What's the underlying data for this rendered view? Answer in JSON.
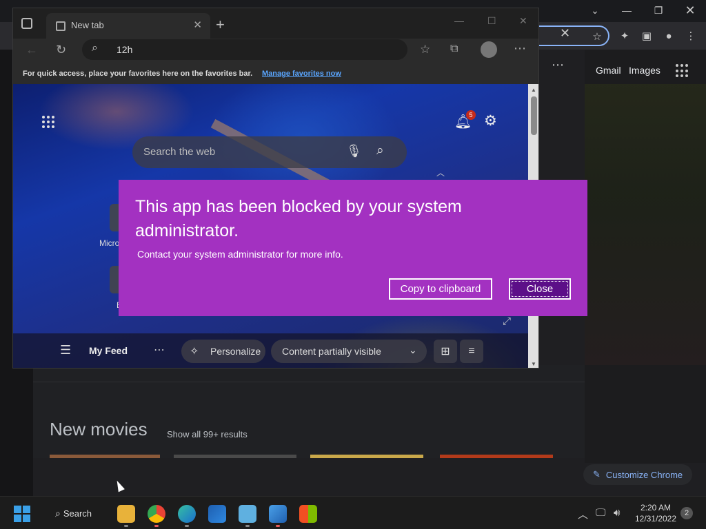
{
  "chrome": {
    "links": {
      "gmail": "Gmail",
      "images": "Images"
    },
    "results": {
      "heading": "New movies",
      "show_all": "Show all 99+ results"
    },
    "customize_label": "Customize Chrome"
  },
  "edge": {
    "tab": {
      "title": "New tab"
    },
    "address": {
      "value": "12h"
    },
    "favorites_bar": {
      "text": "For quick access, place your favorites here on the favorites bar.",
      "link": "Manage favorites now"
    },
    "ntp": {
      "search_placeholder": "Search the web",
      "notification_count": "5",
      "tiles": [
        {
          "label": "Micro"
        },
        {
          "label": "E"
        }
      ],
      "feed": {
        "my_feed": "My Feed",
        "personalize": "Personalize",
        "content_visibility": "Content partially visible"
      }
    }
  },
  "dialog": {
    "title": "This app has been blocked by your system administrator.",
    "message": "Contact your system administrator for more info.",
    "buttons": {
      "copy": "Copy to clipboard",
      "close": "Close"
    },
    "background_color": "#a331c1"
  },
  "taskbar": {
    "search_label": "Search",
    "apps": [
      "file-explorer",
      "chrome",
      "edge",
      "media-player",
      "notepad",
      "paint",
      "microsoft-store"
    ],
    "time": "2:20 AM",
    "date": "12/31/2022",
    "notification_count": "2"
  }
}
